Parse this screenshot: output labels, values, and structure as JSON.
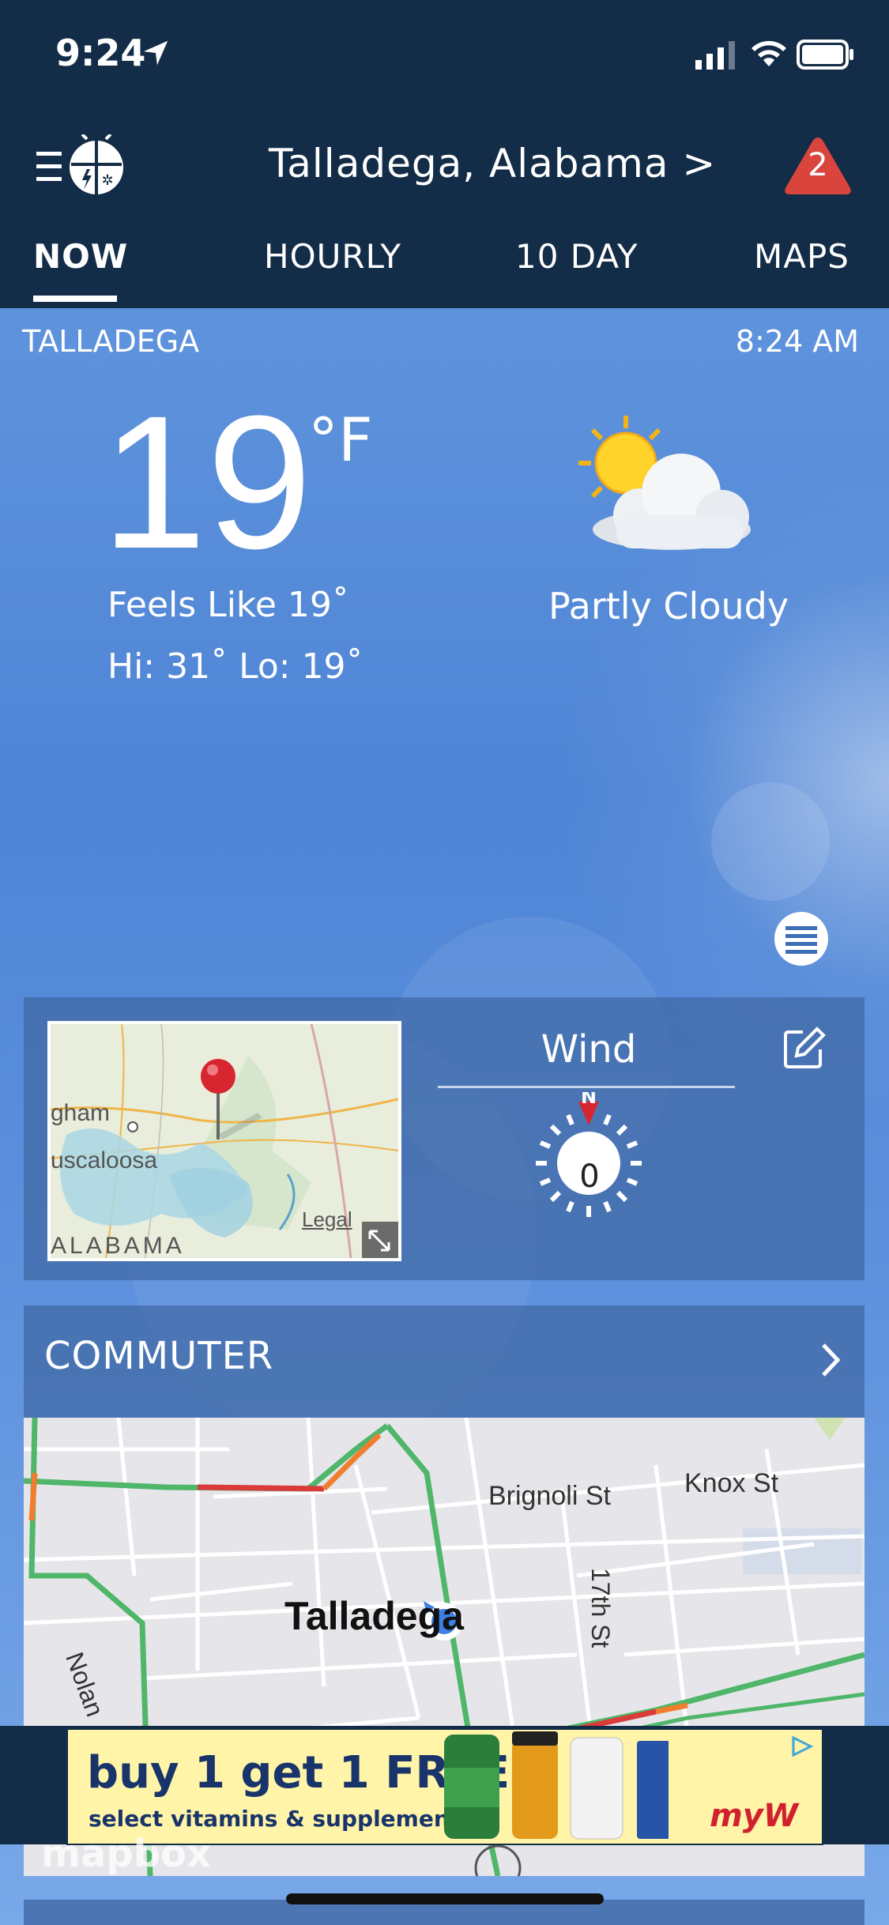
{
  "status_bar": {
    "time": "9:24"
  },
  "header": {
    "location": "Talladega,  Alabama  >",
    "alert_count": "2"
  },
  "tabs": [
    {
      "label": "NOW",
      "selected": true
    },
    {
      "label": "HOURLY",
      "selected": false
    },
    {
      "label": "10  DAY",
      "selected": false
    },
    {
      "label": "MAPS",
      "selected": false
    }
  ],
  "current": {
    "station": "TALLADEGA",
    "observed_time": "8:24  AM",
    "temperature": "19",
    "unit": "°F",
    "feels_like": "Feels  Like  19˚",
    "hi_lo": "Hi: 31˚  Lo: 19˚",
    "condition": "Partly  Cloudy",
    "condition_icon": "partly-cloudy-icon"
  },
  "mini_map": {
    "labels": [
      "gham",
      "uscaloosa",
      "ALABAMA",
      "Legal"
    ]
  },
  "wind": {
    "title": "Wind",
    "direction": "N",
    "speed": "0"
  },
  "commuter": {
    "title": "COMMUTER",
    "streets": [
      "Brignoli St",
      "Knox St",
      "17th St",
      "Talladega",
      "Nolan"
    ]
  },
  "ad": {
    "headline": "buy 1 get 1 FREE",
    "subline": "select vitamins & supplements",
    "brand": "myW"
  },
  "map_attribution": "mapbox",
  "colors": {
    "navy": "#132c47",
    "sky": "#5b8fdc",
    "alert_red": "#d9453d",
    "card": "#4169a5"
  }
}
